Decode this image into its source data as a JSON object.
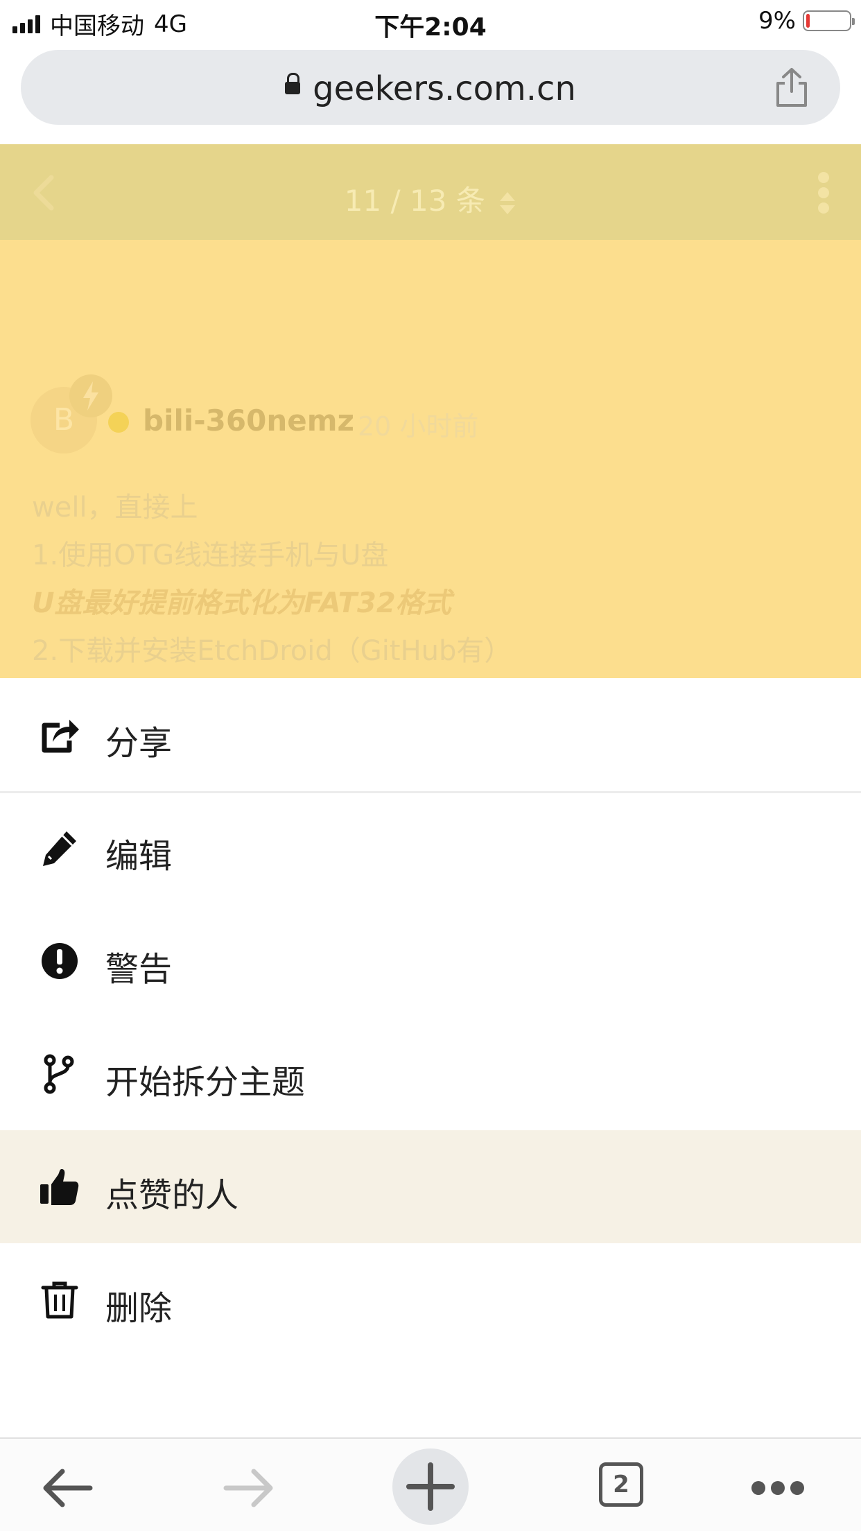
{
  "status_bar": {
    "carrier": "中国移动",
    "network": "4G",
    "time": "下午2:04",
    "battery_percent_text": "9%",
    "battery_level": 0.09,
    "battery_color": "#e53935"
  },
  "browser": {
    "url": "geekers.com.cn",
    "lock_icon": "lock-icon",
    "share_icon": "share-icon",
    "open_tabs": "2"
  },
  "topic_nav": {
    "counter": "11 / 13 条"
  },
  "post": {
    "avatar_letter": "B",
    "username": "bili-360nemz",
    "time_ago": "20 小时前",
    "lines": [
      "well，直接上",
      "1.使用OTG线连接手机与U盘",
      "U盘最好提前格式化为FAT32格式",
      "2.下载并安装EtchDroid（GitHub有）"
    ]
  },
  "menu": {
    "items": [
      {
        "label": "分享",
        "icon": "share-icon"
      },
      {
        "label": "编辑",
        "icon": "pencil-icon"
      },
      {
        "label": "警告",
        "icon": "exclamation-circle-icon"
      },
      {
        "label": "开始拆分主题",
        "icon": "code-fork-icon"
      },
      {
        "label": "点赞的人",
        "icon": "thumbs-up-icon"
      },
      {
        "label": "删除",
        "icon": "trash-icon"
      }
    ]
  },
  "colors": {
    "page_bg": "#fcde8e",
    "highlight_row": "#f6f1e5"
  }
}
